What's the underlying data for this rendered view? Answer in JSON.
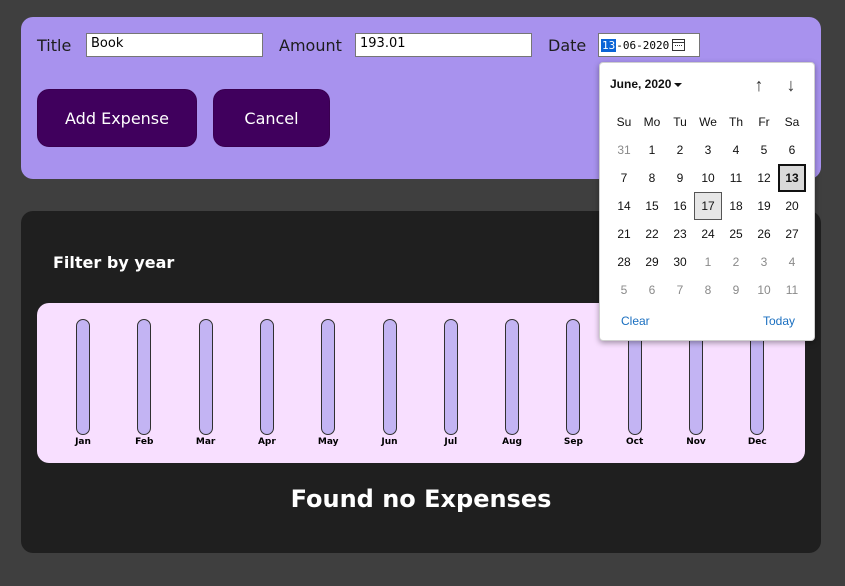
{
  "form": {
    "title_label": "Title",
    "title_value": "Book",
    "amount_label": "Amount",
    "amount_value": "193.01",
    "date_label": "Date",
    "date_day": "13",
    "date_rest": "-06-2020",
    "add_label": "Add Expense",
    "cancel_label": "Cancel"
  },
  "expenses": {
    "filter_label": "Filter by year",
    "empty_message": "Found no Expenses",
    "months": [
      {
        "label": "Jan",
        "fill": 0
      },
      {
        "label": "Feb",
        "fill": 0
      },
      {
        "label": "Mar",
        "fill": 0
      },
      {
        "label": "Apr",
        "fill": 0
      },
      {
        "label": "May",
        "fill": 0
      },
      {
        "label": "Jun",
        "fill": 0
      },
      {
        "label": "Jul",
        "fill": 0
      },
      {
        "label": "Aug",
        "fill": 0
      },
      {
        "label": "Sep",
        "fill": 0
      },
      {
        "label": "Oct",
        "fill": 0
      },
      {
        "label": "Nov",
        "fill": 0
      },
      {
        "label": "Dec",
        "fill": 0
      }
    ]
  },
  "picker": {
    "month_label": "June, 2020",
    "up_icon": "arrow-up-icon",
    "down_icon": "arrow-down-icon",
    "weekdays": [
      "Su",
      "Mo",
      "Tu",
      "We",
      "Th",
      "Fr",
      "Sa"
    ],
    "weeks": [
      [
        {
          "d": "31",
          "o": true
        },
        {
          "d": "1"
        },
        {
          "d": "2"
        },
        {
          "d": "3"
        },
        {
          "d": "4"
        },
        {
          "d": "5"
        },
        {
          "d": "6"
        }
      ],
      [
        {
          "d": "7"
        },
        {
          "d": "8"
        },
        {
          "d": "9"
        },
        {
          "d": "10"
        },
        {
          "d": "11"
        },
        {
          "d": "12"
        },
        {
          "d": "13",
          "sel": true
        }
      ],
      [
        {
          "d": "14"
        },
        {
          "d": "15"
        },
        {
          "d": "16"
        },
        {
          "d": "17",
          "today": true
        },
        {
          "d": "18"
        },
        {
          "d": "19"
        },
        {
          "d": "20"
        }
      ],
      [
        {
          "d": "21"
        },
        {
          "d": "22"
        },
        {
          "d": "23"
        },
        {
          "d": "24"
        },
        {
          "d": "25"
        },
        {
          "d": "26"
        },
        {
          "d": "27"
        }
      ],
      [
        {
          "d": "28"
        },
        {
          "d": "29"
        },
        {
          "d": "30"
        },
        {
          "d": "1",
          "o": true
        },
        {
          "d": "2",
          "o": true
        },
        {
          "d": "3",
          "o": true
        },
        {
          "d": "4",
          "o": true
        }
      ],
      [
        {
          "d": "5",
          "o": true
        },
        {
          "d": "6",
          "o": true
        },
        {
          "d": "7",
          "o": true
        },
        {
          "d": "8",
          "o": true
        },
        {
          "d": "9",
          "o": true
        },
        {
          "d": "10",
          "o": true
        },
        {
          "d": "11",
          "o": true
        }
      ]
    ],
    "clear_label": "Clear",
    "today_label": "Today"
  },
  "colors": {
    "form_bg": "#a892ee",
    "button_bg": "#40005d",
    "panel_bg": "#1f1f1f",
    "chart_bg": "#f8dfff",
    "bar_bg": "#c3b4f3"
  }
}
